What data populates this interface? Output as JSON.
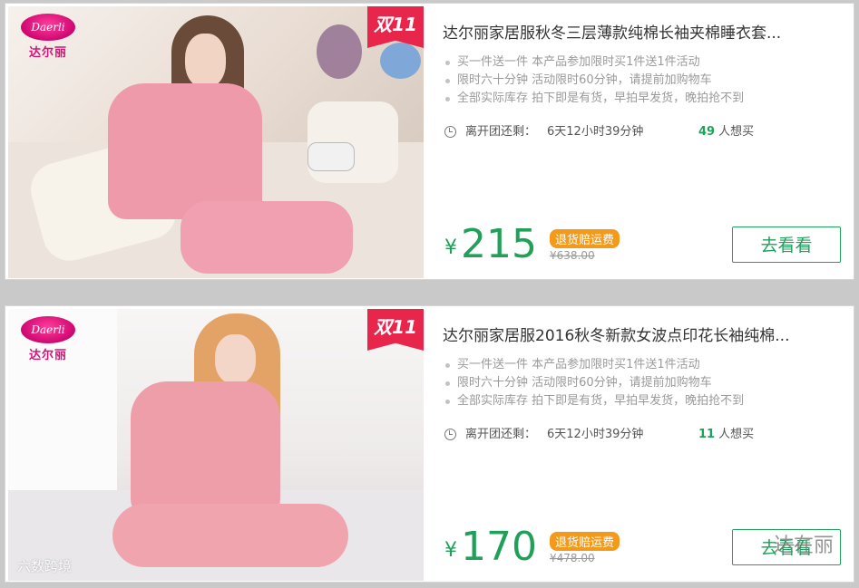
{
  "products": [
    {
      "brand_en": "Daerli",
      "brand_cn": "达尔丽",
      "promo_flag": "双11",
      "title": "达尔丽家居服秋冬三层薄款纯棉长袖夹棉睡衣套...",
      "bullets": [
        "买一件送一件 本产品参加限时买1件送1件活动",
        "限时六十分钟 活动限时60分钟，请提前加购物车",
        "全部实际库存 拍下即是有货，早拍早发货，晚拍抢不到"
      ],
      "timer_label": "离开团还剩：",
      "timer_value": "6天12小时39分钟",
      "want_count": "49",
      "want_label": "人想买",
      "currency": "¥",
      "price": "215",
      "tag": "退货赔运费",
      "original_price": "¥638.00",
      "button_label": "去看看"
    },
    {
      "brand_en": "Daerli",
      "brand_cn": "达尔丽",
      "promo_flag": "双11",
      "title": "达尔丽家居服2016秋冬新款女波点印花长袖纯棉...",
      "bullets": [
        "买一件送一件 本产品参加限时买1件送1件活动",
        "限时六十分钟 活动限时60分钟，请提前加购物车",
        "全部实际库存 拍下即是有货，早拍早发货，晚拍抢不到"
      ],
      "timer_label": "离开团还剩：",
      "timer_value": "6天12小时39分钟",
      "want_count": "11",
      "want_label": "人想买",
      "currency": "¥",
      "price": "170",
      "tag": "退货赔运费",
      "original_price": "¥478.00",
      "button_label": "去看看"
    }
  ],
  "watermark_left": "六数跨境",
  "watermark_right": "达在丽",
  "colors": {
    "accent_green": "#21a05a",
    "tag_orange": "#f39a1a",
    "flag_red": "#e8254a",
    "brand_pink": "#d4147a"
  }
}
